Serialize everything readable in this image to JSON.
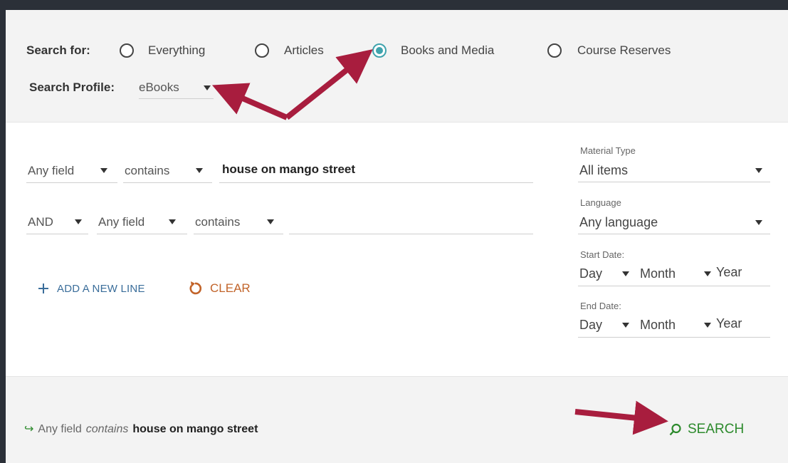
{
  "search_for": {
    "label": "Search for:",
    "options": [
      "Everything",
      "Articles",
      "Books and Media",
      "Course Reserves"
    ],
    "selected": "Books and Media"
  },
  "search_profile": {
    "label": "Search Profile:",
    "value": "eBooks"
  },
  "rows": [
    {
      "field": "Any field",
      "operator": "contains",
      "value": "house on mango street"
    },
    {
      "boolean": "AND",
      "field": "Any field",
      "operator": "contains",
      "value": ""
    }
  ],
  "actions": {
    "add_line": "ADD A NEW LINE",
    "clear": "CLEAR"
  },
  "filters": {
    "material_type": {
      "label": "Material Type",
      "value": "All items"
    },
    "language": {
      "label": "Language",
      "value": "Any language"
    },
    "start_date": {
      "label": "Start Date:",
      "day": "Day",
      "month": "Month",
      "year": "Year"
    },
    "end_date": {
      "label": "End Date:",
      "day": "Day",
      "month": "Month",
      "year": "Year"
    }
  },
  "summary": {
    "field": "Any field",
    "operator": "contains",
    "value": "house on mango street"
  },
  "search_button": "SEARCH",
  "colors": {
    "accent_radio": "#3fa3ad",
    "search_green": "#2c8a2c",
    "clear_orange": "#c2642a",
    "add_blue": "#3a6d9a",
    "annotation_arrow": "#a81d3e"
  }
}
